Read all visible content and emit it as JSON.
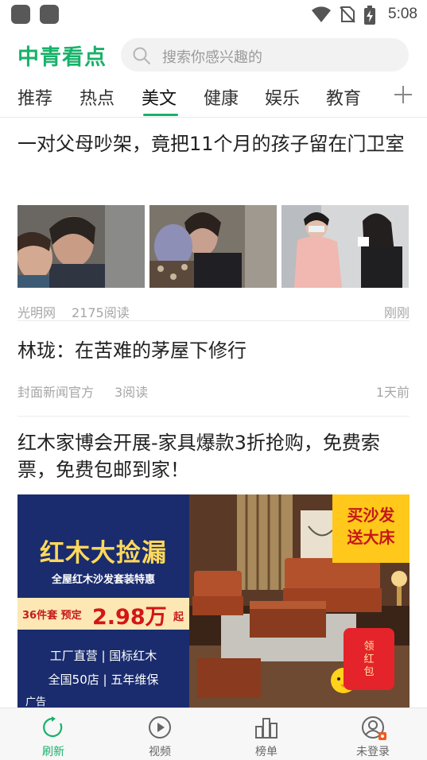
{
  "status_bar": {
    "time": "5:08",
    "icons": [
      "app-icon",
      "app-icon",
      "wifi-icon",
      "no-sim-icon",
      "battery-charging-icon"
    ]
  },
  "header": {
    "logo": "中青看点",
    "search_placeholder": "搜索你感兴趣的"
  },
  "tabs": {
    "items": [
      "推荐",
      "热点",
      "美文",
      "健康",
      "娱乐",
      "教育"
    ],
    "active": "美文",
    "add_icon": "plus-icon"
  },
  "feed": {
    "articles": [
      {
        "title": "一对父母吵架，竟把11个月的孩子留在门卫室",
        "source": "光明网",
        "reads": "2175阅读",
        "time": "刚刚",
        "images": [
          "crying-woman-photo",
          "mother-and-child-photo",
          "nurse-photo"
        ]
      },
      {
        "title": "林珑：在苦难的茅屋下修行",
        "source": "封面新闻官方",
        "reads": "3阅读",
        "time": "1天前"
      },
      {
        "title": "红木家博会开展-家具爆款3折抢购，免费索票，免费包邮到家！"
      }
    ],
    "ad": {
      "headline": "红木大捡漏",
      "subheadline": "全屋红木沙发套装特惠",
      "price_prefix": "36件套 预定",
      "price": "2.98万",
      "price_suffix": "起",
      "line1": "工厂直营 | 国标红木",
      "line2": "全国50店 | 五年维保",
      "tag": "广告",
      "promo_line1": "买沙发",
      "promo_line2": "送大床",
      "envelope": "领红包"
    }
  },
  "bottom_nav": {
    "items": [
      {
        "label": "刷新",
        "icon": "refresh-icon",
        "active": true
      },
      {
        "label": "视频",
        "icon": "play-icon",
        "active": false
      },
      {
        "label": "榜单",
        "icon": "ranking-icon",
        "active": false
      },
      {
        "label": "未登录",
        "icon": "user-icon",
        "active": false
      }
    ]
  },
  "colors": {
    "brand": "#17b26a",
    "ad_blue": "#1a2c6e",
    "ad_gold": "#ffd95a",
    "ad_red": "#d21616"
  }
}
